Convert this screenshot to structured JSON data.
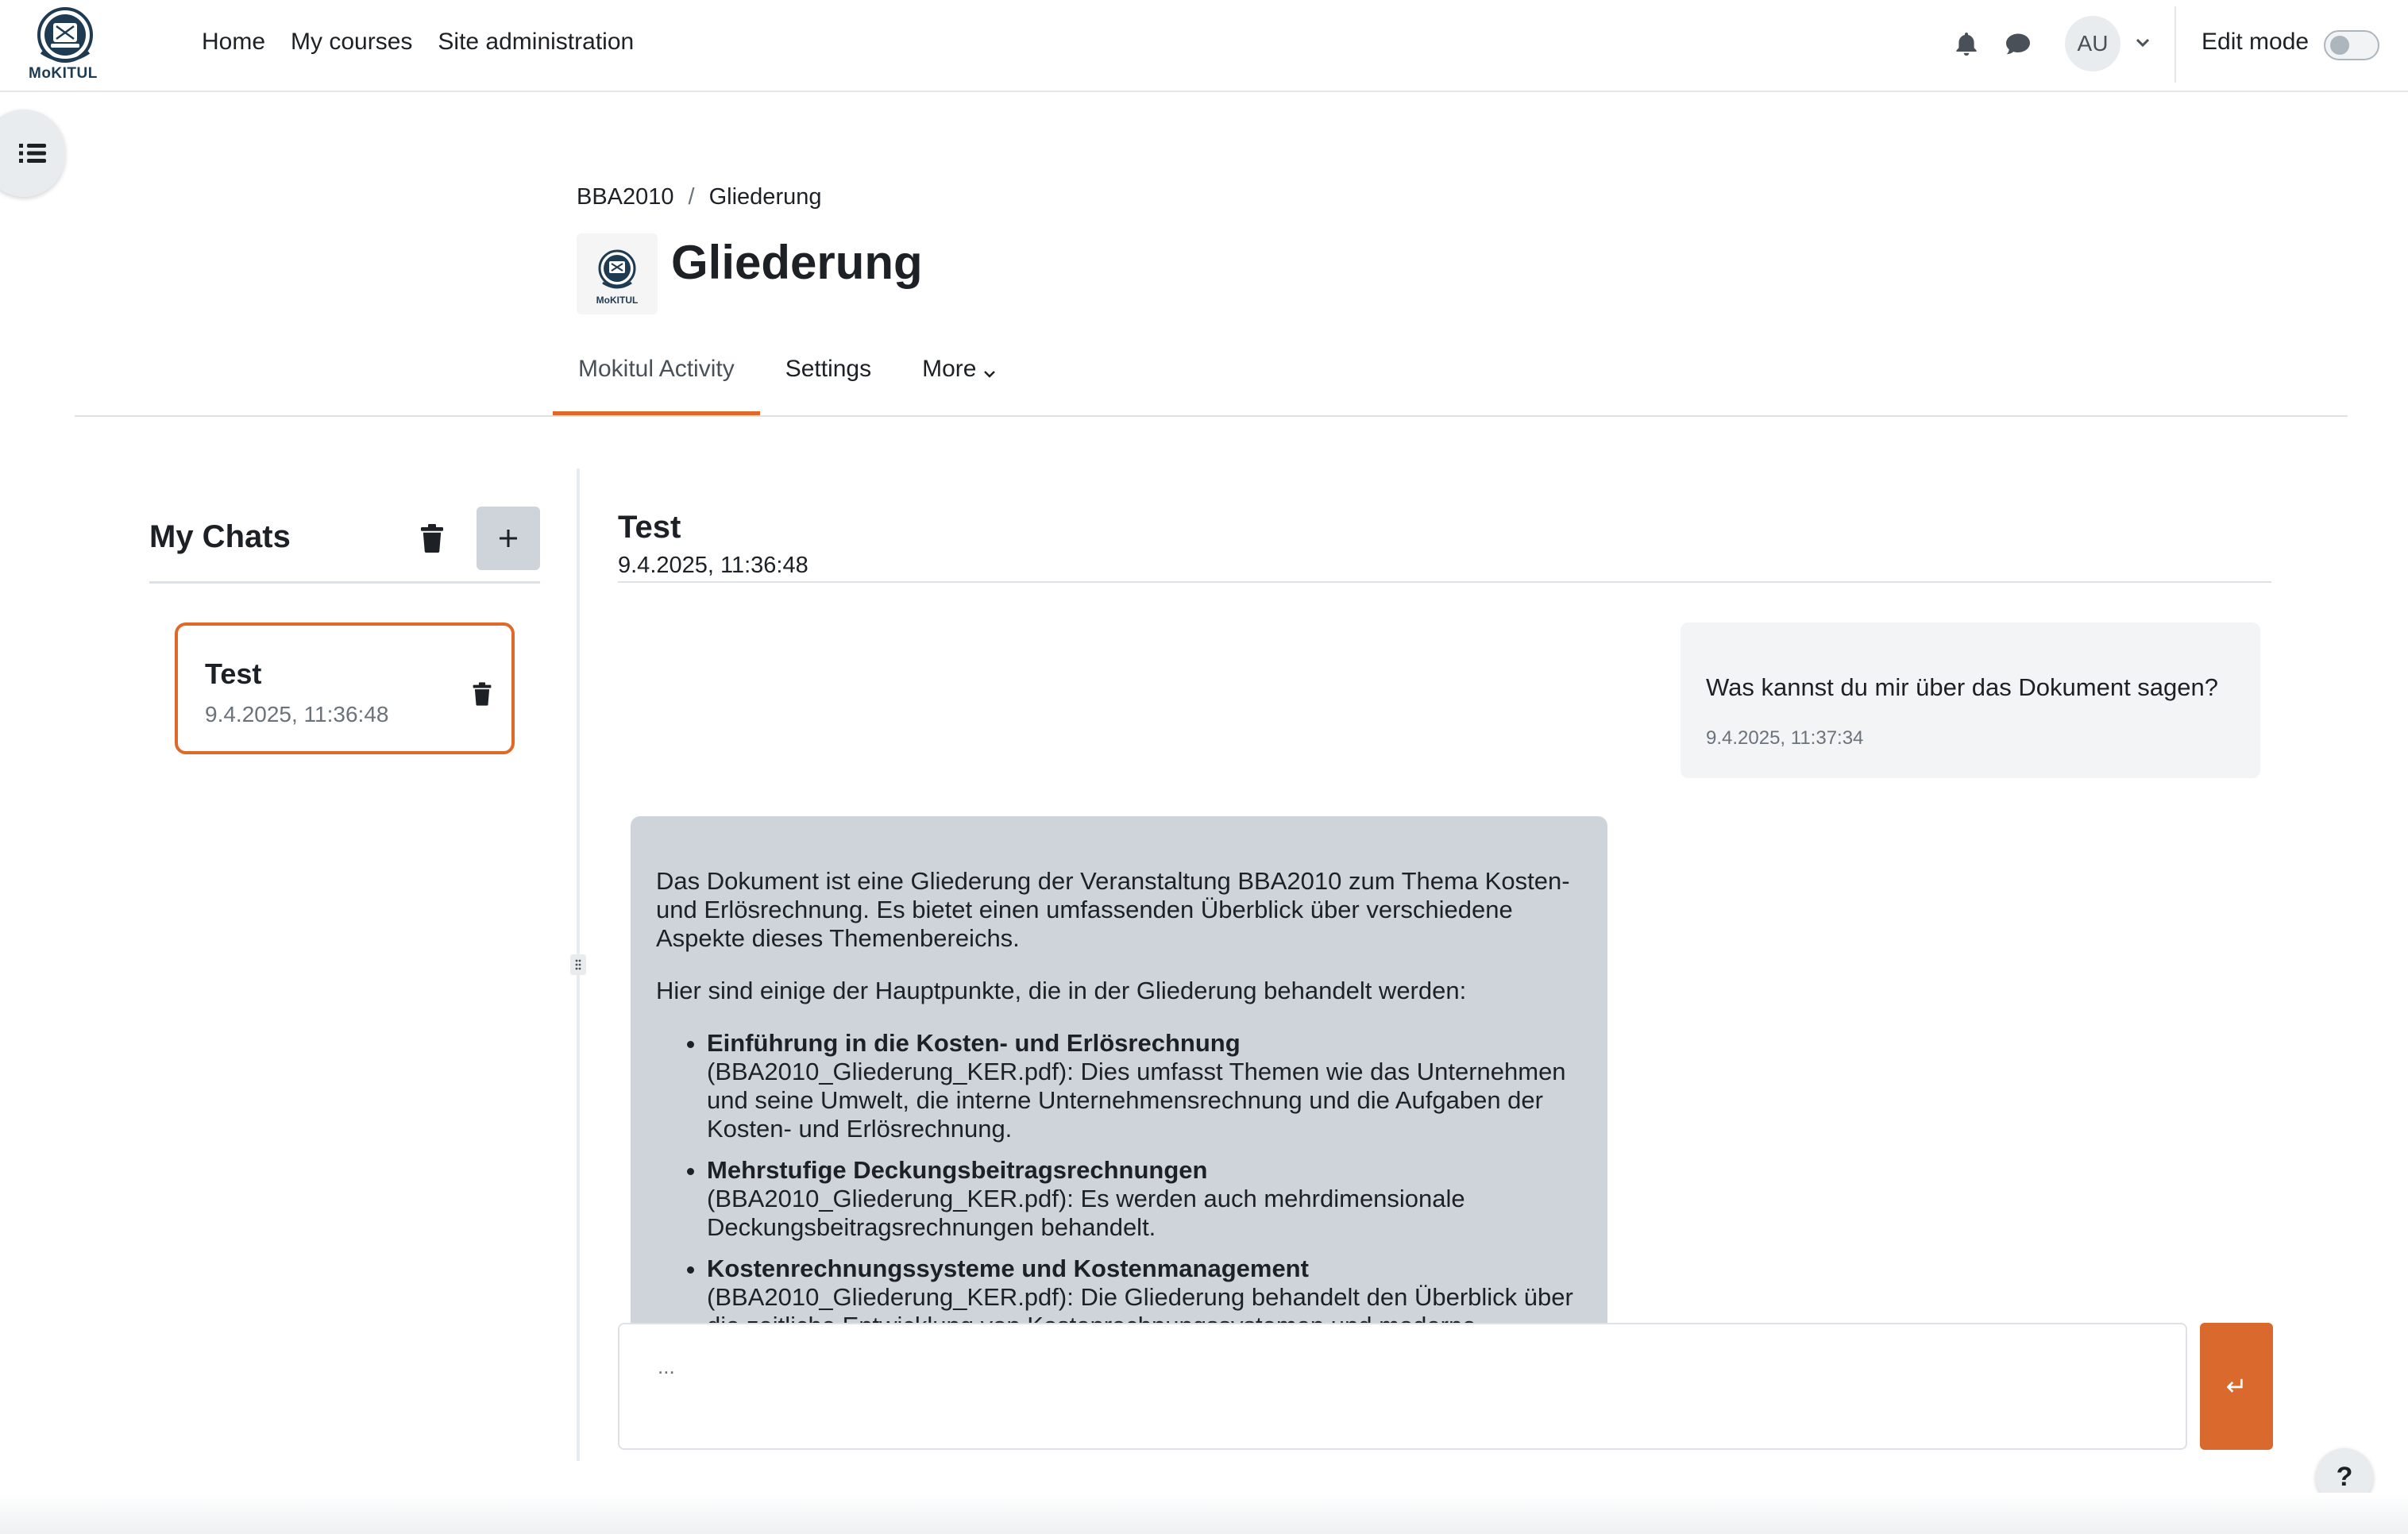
{
  "brand": {
    "logo_text": "MoKITUL"
  },
  "primary_nav": [
    "Home",
    "My courses",
    "Site administration"
  ],
  "user": {
    "initials": "AU"
  },
  "edit_mode": {
    "label": "Edit mode",
    "enabled": false
  },
  "breadcrumb": [
    "BBA2010",
    "Gliederung"
  ],
  "breadcrumb_separator": "/",
  "page": {
    "title": "Gliederung",
    "activity_icon_text": "MoKITUL"
  },
  "tabs": [
    {
      "label": "Mokitul Activity",
      "active": true
    },
    {
      "label": "Settings",
      "active": false
    },
    {
      "label": "More",
      "active": false
    }
  ],
  "chats": {
    "title": "My Chats",
    "items": [
      {
        "title": "Test",
        "date": "9.4.2025, 11:36:48",
        "selected": true
      }
    ]
  },
  "conversation": {
    "title": "Test",
    "date": "9.4.2025, 11:36:48",
    "user_message": {
      "text": "Was kannst du mir über das Dokument sagen?",
      "time": "9.4.2025, 11:37:34"
    },
    "bot_message": {
      "paragraphs": [
        "Das Dokument ist eine Gliederung der Veranstaltung BBA2010 zum Thema Kosten- und Erlösrechnung. Es bietet einen umfassenden Überblick über verschiedene Aspekte dieses Themenbereichs.",
        "Hier sind einige der Hauptpunkte, die in der Gliederung behandelt werden:"
      ],
      "items": [
        {
          "title": "Einführung in die Kosten- und Erlösrechnung",
          "text": "(BBA2010_Gliederung_KER.pdf): Dies umfasst Themen wie das Unternehmen und seine Umwelt, die interne Unternehmensrechnung und die Aufgaben der Kosten- und Erlösrechnung."
        },
        {
          "title": "Mehrstufige Deckungsbeitragsrechnungen",
          "text": "(BBA2010_Gliederung_KER.pdf): Es werden auch mehrdimensionale Deckungsbeitragsrechnungen behandelt."
        },
        {
          "title": "Kostenrechnungssysteme und Kostenmanagement",
          "text": "(BBA2010_Gliederung_KER.pdf): Die Gliederung behandelt den Überblick über die zeitliche Entwicklung von Kostenrechnungssystemen und moderne"
        }
      ]
    }
  },
  "composer": {
    "placeholder": "...",
    "send_symbol": "↵"
  },
  "help": {
    "label": "?"
  },
  "colors": {
    "accent": "#e0692a",
    "bot_bubble": "#ced4da",
    "user_bubble": "#f3f4f6"
  }
}
